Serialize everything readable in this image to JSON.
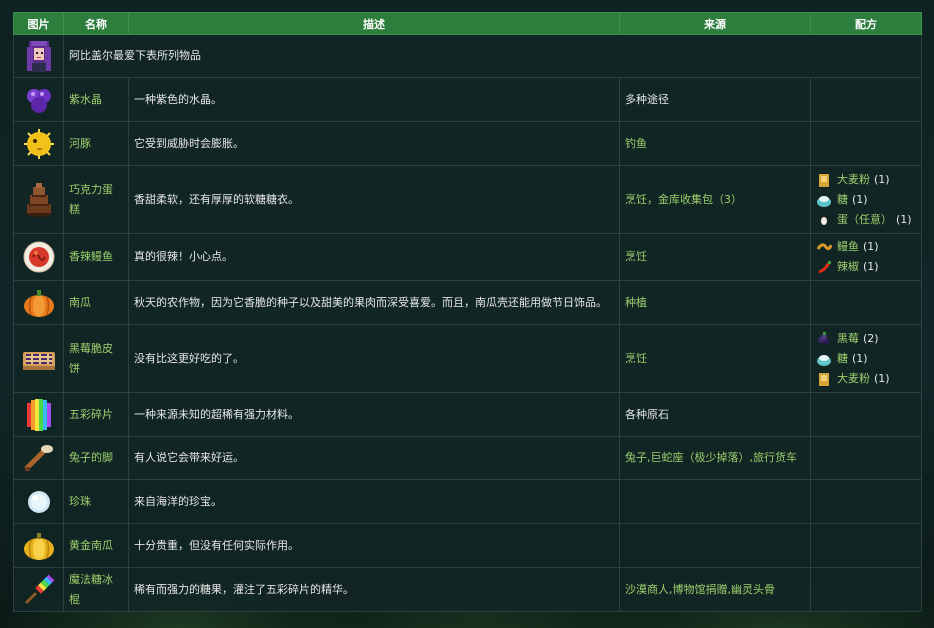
{
  "headers": {
    "image": "图片",
    "name": "名称",
    "desc": "描述",
    "source": "来源",
    "recipe": "配方"
  },
  "intro": "阿比盖尔最爱下表所列物品",
  "rows": [
    {
      "name": "紫水晶",
      "desc": "一种紫色的水晶。",
      "source": "多种途径",
      "icon": "amethyst-icon"
    },
    {
      "name": "河豚",
      "desc": "它受到威胁时会膨胀。",
      "source": "钓鱼",
      "icon": "pufferfish-icon"
    },
    {
      "name": "巧克力蛋糕",
      "desc": "香甜柔软，还有厚厚的软糖糖衣。",
      "source_a": "烹饪",
      "source_sep": "，",
      "source_b": "金库收集包（3）",
      "icon": "chocolate-cake-icon",
      "recipe": [
        {
          "item": "大麦粉",
          "qty": "(1)"
        },
        {
          "item": "糖",
          "qty": "(1)"
        },
        {
          "item": "蛋（任意）",
          "qty": "(1)"
        }
      ]
    },
    {
      "name": "香辣鳗鱼",
      "desc": "真的很辣！小心点。",
      "source": "烹饪",
      "icon": "spicy-eel-icon",
      "recipe": [
        {
          "item": "鳗鱼",
          "qty": "(1)"
        },
        {
          "item": "辣椒",
          "qty": "(1)"
        }
      ]
    },
    {
      "name": "南瓜",
      "desc": "秋天的农作物，因为它香脆的种子以及甜美的果肉而深受喜爱。而且，南瓜壳还能用做节日饰品。",
      "source": "种植",
      "icon": "pumpkin-icon"
    },
    {
      "name": "黑莓脆皮饼",
      "desc": "没有比这更好吃的了。",
      "source": "烹饪",
      "icon": "blackberry-cobbler-icon",
      "recipe": [
        {
          "item": "黑莓",
          "qty": "(2)"
        },
        {
          "item": "糖",
          "qty": "(1)"
        },
        {
          "item": "大麦粉",
          "qty": "(1)"
        }
      ]
    },
    {
      "name": "五彩碎片",
      "desc": "一种来源未知的超稀有强力材料。",
      "source": "各种原石",
      "icon": "prismatic-shard-icon"
    },
    {
      "name": "兔子的脚",
      "desc": "有人说它会带来好运。",
      "source_a": "兔子",
      "source_sep": ",",
      "source_b": "巨蛇座（极少掉落）",
      "source_sep2": ",",
      "source_c": "旅行货车",
      "icon": "rabbit-foot-icon"
    },
    {
      "name": "珍珠",
      "desc": "来自海洋的珍宝。",
      "source": "",
      "icon": "pearl-icon"
    },
    {
      "name": "黄金南瓜",
      "desc": "十分贵重，但没有任何实际作用。",
      "source": "",
      "icon": "golden-pumpkin-icon"
    },
    {
      "name": "魔法糖冰棍",
      "desc": "稀有而强力的糖果，灌注了五彩碎片的精华。",
      "source_a": "沙漠商人",
      "source_sep": ",",
      "source_b": "博物馆捐赠",
      "source_sep2": ",",
      "source_c": "幽灵头骨",
      "icon": "magic-rock-candy-icon"
    }
  ],
  "colors": {
    "header": "#2d7d3d",
    "link": "#9ccf6c",
    "text": "#e6e6e6",
    "border": "#2b4141"
  }
}
